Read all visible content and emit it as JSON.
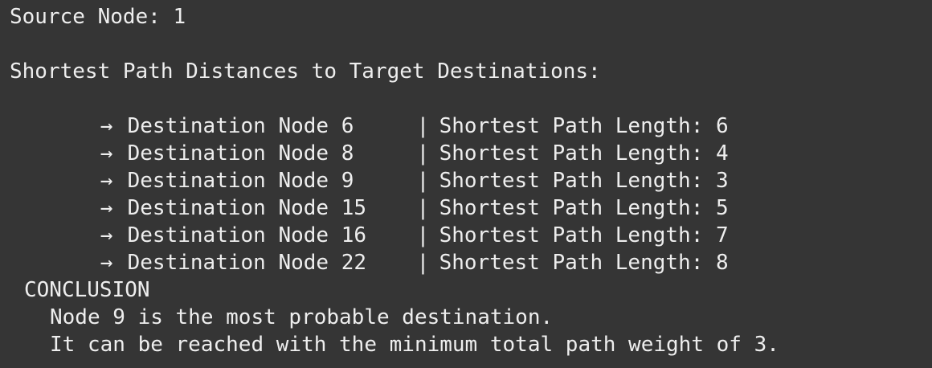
{
  "terminal": {
    "source_line": "Source Node: 1",
    "section_heading": "Shortest Path Distances to Target Destinations:",
    "arrow_glyph": "→",
    "separator_glyph": "|",
    "rows": [
      {
        "destination": "Destination Node 6",
        "length": "Shortest Path Length: 6"
      },
      {
        "destination": "Destination Node 8",
        "length": "Shortest Path Length: 4"
      },
      {
        "destination": "Destination Node 9",
        "length": "Shortest Path Length: 3"
      },
      {
        "destination": "Destination Node 15",
        "length": "Shortest Path Length: 5"
      },
      {
        "destination": "Destination Node 16",
        "length": "Shortest Path Length: 7"
      },
      {
        "destination": "Destination Node 22",
        "length": "Shortest Path Length: 8"
      }
    ],
    "conclusion_heading": "CONCLUSION",
    "conclusion_lines": [
      "Node 9 is the most probable destination.",
      "It can be reached with the minimum total path weight of 3."
    ],
    "colors": {
      "background": "#353535",
      "text": "#eeeeee"
    }
  }
}
